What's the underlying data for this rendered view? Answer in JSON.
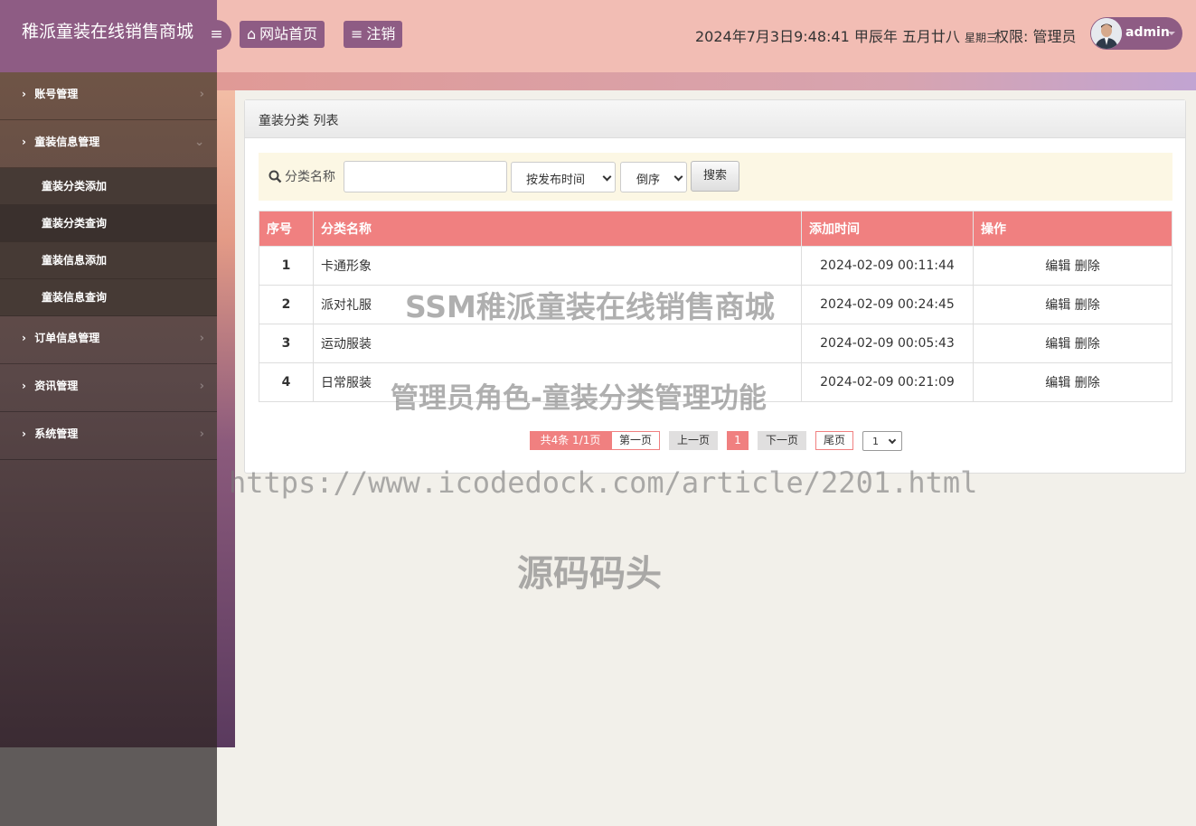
{
  "brand": {
    "title": "稚派童装在线销售商城"
  },
  "topnav": {
    "home_label": "网站首页",
    "logout_label": "注销"
  },
  "header": {
    "datetime": "2024年7月3日9:48:41 甲辰年 五月廿八",
    "weekday": "星期三",
    "permission": "权限: 管理员",
    "username": "admin"
  },
  "sidebar": {
    "items": [
      {
        "label": "账号管理"
      },
      {
        "label": "童装信息管理"
      },
      {
        "label": "订单信息管理"
      },
      {
        "label": "资讯管理"
      },
      {
        "label": "系统管理"
      }
    ],
    "subitems": [
      {
        "label": "童装分类添加"
      },
      {
        "label": "童装分类查询"
      },
      {
        "label": "童装信息添加"
      },
      {
        "label": "童装信息查询"
      }
    ]
  },
  "panel": {
    "title": "童装分类 列表"
  },
  "search": {
    "label": "分类名称",
    "value": "",
    "sort_field": "按发布时间",
    "sort_order": "倒序",
    "button": "搜索"
  },
  "table": {
    "headers": [
      "序号",
      "分类名称",
      "添加时间",
      "操作"
    ],
    "rows": [
      {
        "no": "1",
        "name": "卡通形象",
        "time": "2024-02-09 00:11:44",
        "ops": "编辑 删除"
      },
      {
        "no": "2",
        "name": "派对礼服",
        "time": "2024-02-09 00:24:45",
        "ops": "编辑 删除"
      },
      {
        "no": "3",
        "name": "运动服装",
        "time": "2024-02-09 00:05:43",
        "ops": "编辑 删除"
      },
      {
        "no": "4",
        "name": "日常服装",
        "time": "2024-02-09 00:21:09",
        "ops": "编辑 删除"
      }
    ]
  },
  "pagination": {
    "info": "共4条 1/1页",
    "first": "第一页",
    "prev": "上一页",
    "current": "1",
    "next": "下一页",
    "last": "尾页",
    "select": "1"
  },
  "watermarks": {
    "line1": "SSM稚派童装在线销售商城",
    "line2": "管理员角色-童装分类管理功能",
    "line3": "https://www.icodedock.com/article/2201.html",
    "line4": "源码码头"
  },
  "colors": {
    "accent": "#8e5c84",
    "table_header": "#f08080",
    "topbar": "#f2bdb4"
  }
}
